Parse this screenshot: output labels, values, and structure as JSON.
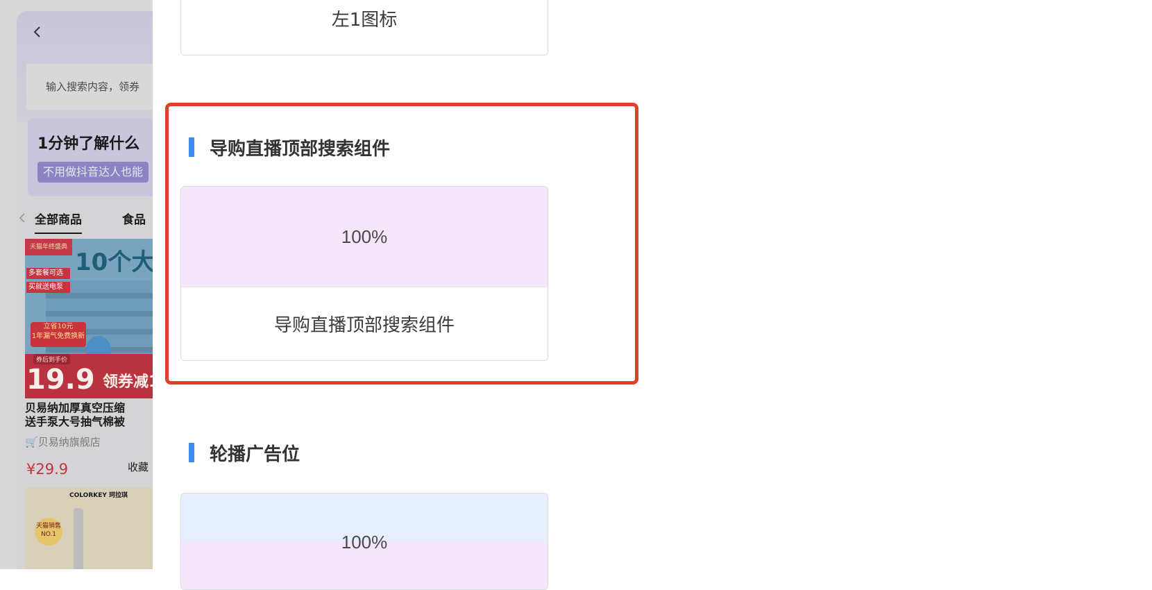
{
  "preview": {
    "back_icon": "chevron-left-icon",
    "search_placeholder": "输入搜索内容，领券",
    "promo_title": "1分钟了解什么",
    "promo_subtitle": "不用做抖音达人也能",
    "tabs": [
      "全部商品",
      "食品"
    ],
    "tabs_prev_icon": "chevron-left-icon",
    "product1": {
      "badge": "天猫年终盛典",
      "headline": "10个大",
      "tag1": "多套餐可选",
      "tag2": "买就送电泵",
      "flame_text": "立省10元\n1年漏气免费换新",
      "after_coupon": "券后到手价",
      "price_big": "19.9",
      "coupon_text": "领券减1",
      "name": "贝易纳加厚真空压缩\n送手泵大号抽气棉被",
      "shop": "贝易纳旗舰店",
      "price": "¥29.9",
      "fav": "收藏"
    },
    "product2": {
      "brand": "COLORKEY 珂拉琪",
      "medal": "天猫销售 NO.1"
    }
  },
  "panel": {
    "card_top_caption": "左1图标",
    "section1": {
      "title": "导购直播顶部搜索组件",
      "thumb_label": "100%",
      "thumb_color": "#f6e6fb",
      "caption": "导购直播顶部搜索组件"
    },
    "section2": {
      "title": "轮播广告位",
      "thumb_label": "100%",
      "thumb_color_top": "#e7efff",
      "thumb_color_bottom": "#f6e6fb"
    },
    "highlight_color": "#e2402a",
    "accent_color": "#3d8df0"
  }
}
